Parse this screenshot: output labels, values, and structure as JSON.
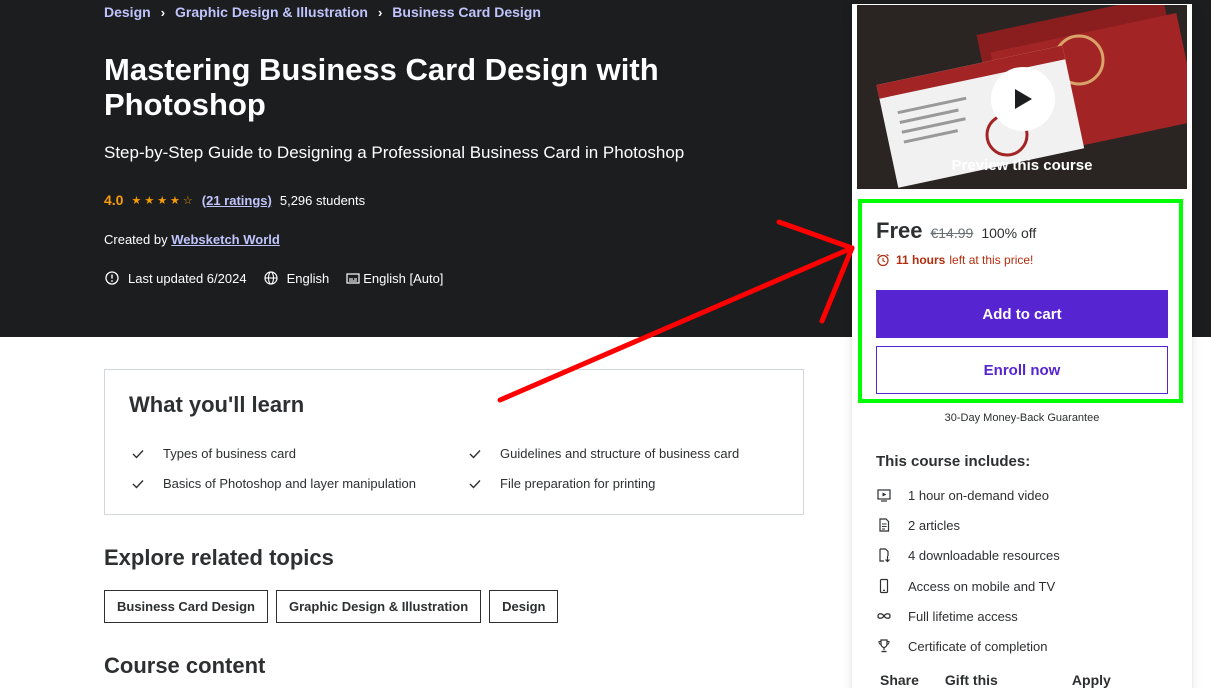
{
  "breadcrumb": {
    "items": [
      "Design",
      "Graphic Design & Illustration",
      "Business Card Design"
    ]
  },
  "course": {
    "title": "Mastering Business Card Design with Photoshop",
    "subtitle": "Step-by-Step Guide to Designing a Professional Business Card in Photoshop",
    "rating": "4.0",
    "stars": 4,
    "ratings_count": "(21 ratings)",
    "students": "5,296 students",
    "created_by_label": "Created by",
    "author": "Websketch World",
    "last_updated": "Last updated 6/2024",
    "language": "English",
    "captions": "English [Auto]"
  },
  "learn": {
    "title": "What you'll learn",
    "items": [
      "Types of business card",
      "Guidelines and structure of business card",
      "Basics of Photoshop and layer manipulation",
      "File preparation for printing"
    ]
  },
  "related": {
    "title": "Explore related topics",
    "topics": [
      "Business Card Design",
      "Graphic Design & Illustration",
      "Design"
    ]
  },
  "content": {
    "title": "Course content"
  },
  "sidebar": {
    "preview_label": "Preview this course",
    "price_free": "Free",
    "price_original": "€14.99",
    "discount": "100% off",
    "timer_hours": "11 hours",
    "timer_rest": "left at this price!",
    "add_to_cart": "Add to cart",
    "enroll_now": "Enroll now",
    "guarantee": "30-Day Money-Back Guarantee",
    "includes_title": "This course includes:",
    "includes": [
      {
        "icon": "video-icon",
        "text": "1 hour on-demand video"
      },
      {
        "icon": "article-icon",
        "text": "2 articles"
      },
      {
        "icon": "download-icon",
        "text": "4 downloadable resources"
      },
      {
        "icon": "mobile-icon",
        "text": "Access on mobile and TV"
      },
      {
        "icon": "infinity-icon",
        "text": "Full lifetime access"
      },
      {
        "icon": "trophy-icon",
        "text": "Certificate of completion"
      }
    ],
    "footer": [
      "Share",
      "Gift this course",
      "Apply Coupon"
    ]
  },
  "colors": {
    "hero_bg": "#1c1d1f",
    "accent_purple": "#5624d0",
    "link_lavender": "#c0c4fc",
    "star_orange": "#f69c08",
    "timer_red": "#b32d0f",
    "highlight_green": "#00ff00",
    "arrow_red": "#ff0000"
  }
}
